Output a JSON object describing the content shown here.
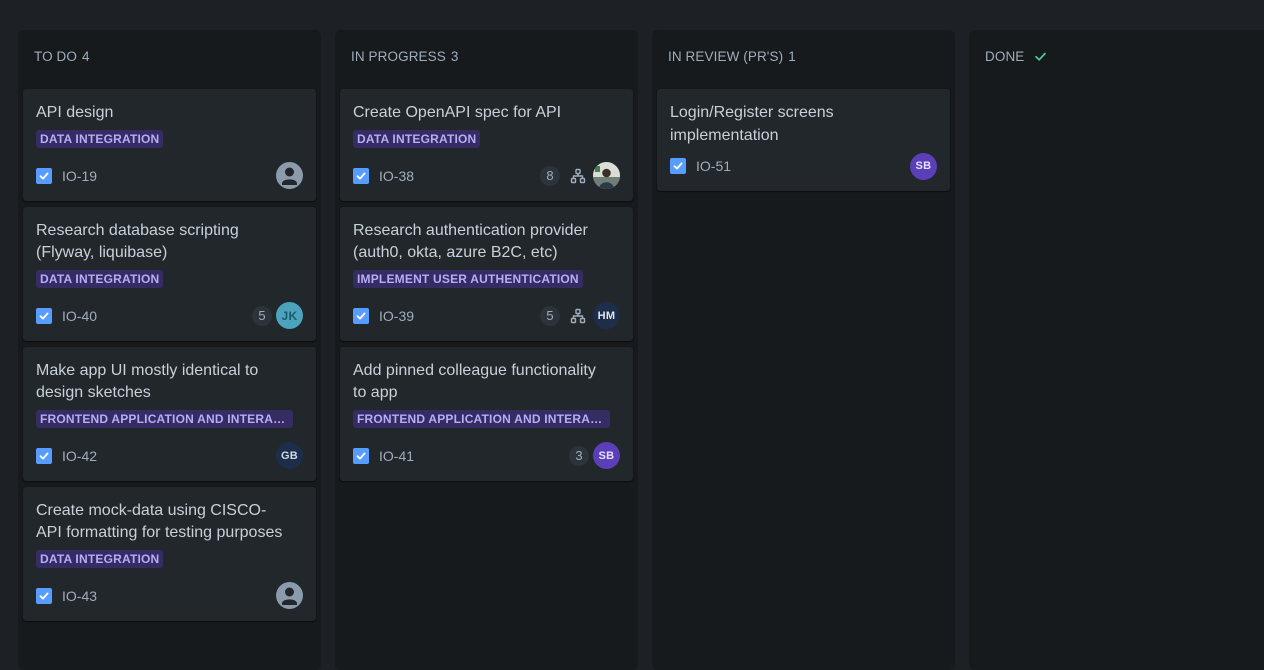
{
  "columns": {
    "todo": {
      "title": "TO DO",
      "count": "4",
      "cards": [
        {
          "title": "API design",
          "label": "DATA INTEGRATION",
          "key": "IO-19",
          "estimate": "",
          "assignee": ""
        },
        {
          "title": "Research database scripting (Flyway, liquibase)",
          "label": "DATA INTEGRATION",
          "key": "IO-40",
          "estimate": "5",
          "assignee": "JK"
        },
        {
          "title": "Make app UI mostly identical to design sketches",
          "label": "FRONTEND APPLICATION AND INTERACT...",
          "key": "IO-42",
          "estimate": "",
          "assignee": "GB"
        },
        {
          "title": "Create mock-data using CISCO-API formatting for testing purposes",
          "label": "DATA INTEGRATION",
          "key": "IO-43",
          "estimate": "",
          "assignee": ""
        }
      ]
    },
    "in_progress": {
      "title": "IN PROGRESS",
      "count": "3",
      "cards": [
        {
          "title": "Create OpenAPI spec for API",
          "label": "DATA INTEGRATION",
          "key": "IO-38",
          "estimate": "8",
          "assignee": ""
        },
        {
          "title": "Research authentication provider (auth0, okta, azure B2C, etc)",
          "label": "IMPLEMENT USER AUTHENTICATION",
          "key": "IO-39",
          "estimate": "5",
          "assignee": "HM"
        },
        {
          "title": "Add pinned colleague functionality to app",
          "label": "FRONTEND APPLICATION AND INTERACT...",
          "key": "IO-41",
          "estimate": "3",
          "assignee": "SB"
        }
      ]
    },
    "in_review": {
      "title": "IN REVIEW (PR'S)",
      "count": "1",
      "cards": [
        {
          "title": "Login/Register screens implementation",
          "key": "IO-51",
          "assignee": "SB"
        }
      ]
    },
    "done": {
      "title": "DONE",
      "check_icon": "check-icon"
    }
  },
  "colors": {
    "background": "#1d2125",
    "column": "#161a1d",
    "card": "#22272b",
    "label_bg": "#352c63",
    "label_text": "#b8acf6",
    "checkbox": "#579dff",
    "done_check": "#4bce97"
  },
  "icons": [
    "checkbox-icon",
    "subtask-icon",
    "user-default-icon",
    "check-icon"
  ]
}
